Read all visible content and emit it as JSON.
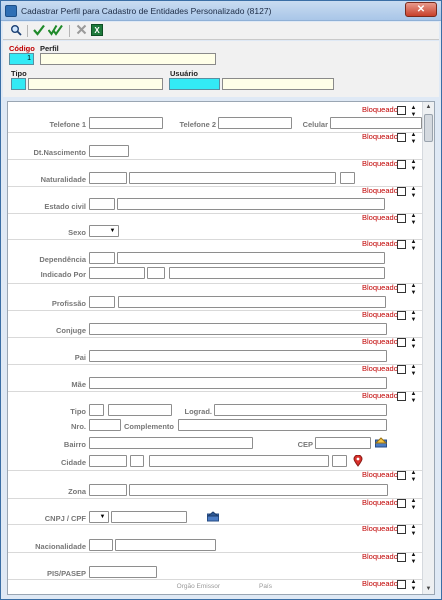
{
  "window": {
    "title": "Cadastrar Perfil para Cadastro de Entidades Personalizado (8127)",
    "close_glyph": "✕"
  },
  "toolbar": {
    "search_icon": "search-icon",
    "confirm_icon": "check-icon",
    "confirm_all_icon": "double-check-icon",
    "cancel_icon": "cancel-icon",
    "excel_icon": "excel-icon"
  },
  "header": {
    "codigo_label": "Código",
    "codigo_value": "1",
    "perfil_label": "Perfil",
    "perfil_value": "",
    "tipo_label": "Tipo",
    "usuario_label": "Usuário"
  },
  "panel": {
    "bloqueado": "Bloqueado",
    "labels": {
      "telefone1": "Telefone 1",
      "telefone2": "Telefone 2",
      "celular": "Celular",
      "dt_nascimento": "Dt.Nascimento",
      "naturalidade": "Naturalidade",
      "estado_civil": "Estado civil",
      "sexo": "Sexo",
      "dependencia": "Dependência",
      "indicado_por": "Indicado Por",
      "profissao": "Profissão",
      "conjuge": "Conjuge",
      "pai": "Pai",
      "mae": "Mãe",
      "tipo": "Tipo",
      "lograd": "Lograd.",
      "nro": "Nro.",
      "complemento": "Complemento",
      "bairro": "Bairro",
      "cep": "CEP",
      "cidade": "Cidade",
      "zona": "Zona",
      "cnpj_cpf": "CNPJ / CPF",
      "nacionalidade": "Nacionalidade",
      "pis_pasep": "PIS/PASEP",
      "orgao_emissor": "Orgão Emissor",
      "pais": "País"
    }
  },
  "colors": {
    "cyan": "#33eaf5",
    "red_label": "#c00000"
  }
}
